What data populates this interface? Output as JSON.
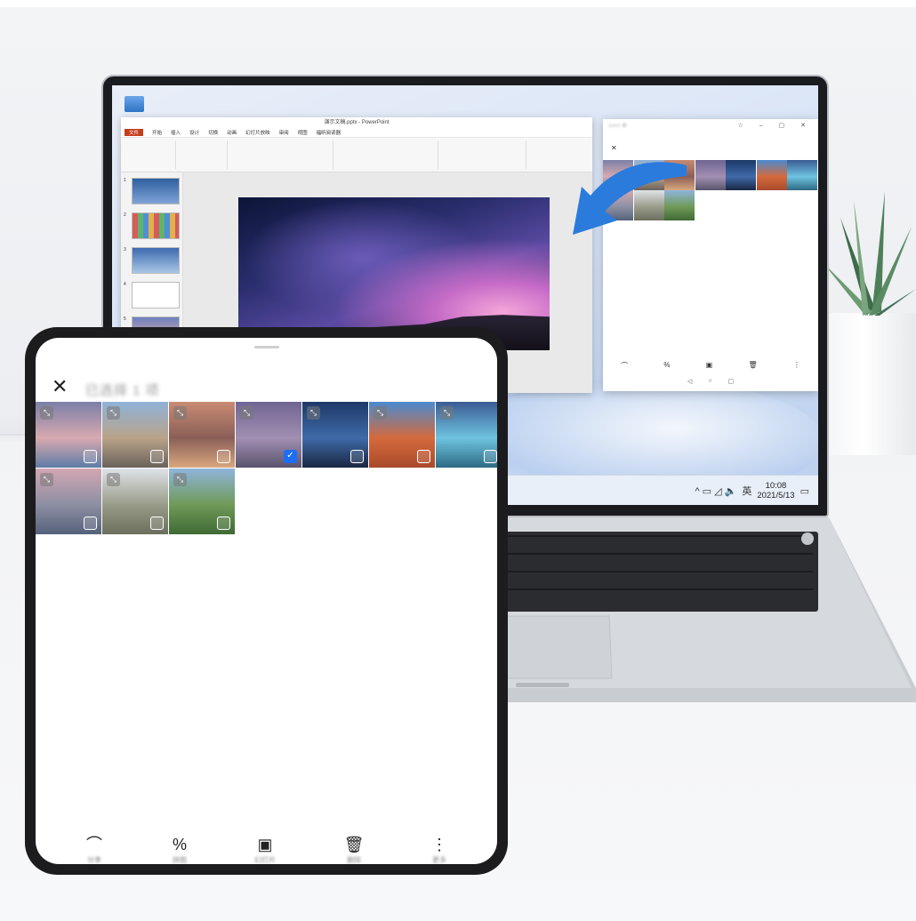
{
  "powerpoint": {
    "window_title": "演示文稿.pptx - PowerPoint",
    "tabs": [
      "文件",
      "开始",
      "插入",
      "设计",
      "切换",
      "动画",
      "幻灯片放映",
      "审阅",
      "视图",
      "福昕阅读器"
    ],
    "slide_numbers": [
      "1",
      "2",
      "3",
      "4",
      "5"
    ]
  },
  "mirror_window": {
    "close_symbol": "✕",
    "window_controls": "☆ – ▢ ✕",
    "nav": [
      "◁",
      "○",
      "▢"
    ]
  },
  "taskbar": {
    "time": "10:08",
    "date": "2021/5/13",
    "ime": "英",
    "tray_symbols": "^ ▭ ◿ 🔈"
  },
  "gallery": {
    "close_symbol": "✕",
    "title": "已选择 1 项",
    "selected_index": 3,
    "expand_symbol": "⤡",
    "check_symbol": "✓",
    "photos": [
      {
        "name": "mountain-lake",
        "colors": [
          "#7b7fa8",
          "#d8a9b0",
          "#5e7ca6"
        ]
      },
      {
        "name": "cliff-sunset",
        "colors": [
          "#8fb3d9",
          "#b9a389",
          "#6a625c"
        ]
      },
      {
        "name": "pier-dusk",
        "colors": [
          "#c98b72",
          "#8a5f58",
          "#d9a77e"
        ]
      },
      {
        "name": "starry-hills",
        "colors": [
          "#6f6593",
          "#a28fb2",
          "#59546d"
        ]
      },
      {
        "name": "night-stream",
        "colors": [
          "#1d3968",
          "#3f6aa8",
          "#1a2742"
        ]
      },
      {
        "name": "red-dunes",
        "colors": [
          "#4a8bd0",
          "#d46a3c",
          "#a84a2b"
        ]
      },
      {
        "name": "alpine-lake",
        "colors": [
          "#3a5b93",
          "#6ec3e0",
          "#2d6a83"
        ]
      },
      {
        "name": "pink-peaks",
        "colors": [
          "#d3a7b3",
          "#8d8fa3",
          "#55617a"
        ]
      },
      {
        "name": "misty-cliffs",
        "colors": [
          "#dfe3e7",
          "#9a9c8a",
          "#6b6e5c"
        ]
      },
      {
        "name": "green-valley",
        "colors": [
          "#8fb5dc",
          "#6f9a57",
          "#3f6a34"
        ]
      }
    ]
  },
  "toolbar": {
    "items": [
      {
        "icon": "share-icon",
        "glyph": "⌒",
        "label": "分享"
      },
      {
        "icon": "collage-icon",
        "glyph": "%",
        "label": "拼图"
      },
      {
        "icon": "slideshow-icon",
        "glyph": "▣",
        "label": "幻灯片"
      },
      {
        "icon": "delete-icon",
        "glyph": "🗑",
        "label": "删除"
      },
      {
        "icon": "more-icon",
        "glyph": "⋮",
        "label": "更多"
      }
    ]
  },
  "colors": {
    "accent_blue": "#1e6ef5",
    "ppt_red": "#c43e1c",
    "arrow_blue": "#2b7bdc"
  }
}
